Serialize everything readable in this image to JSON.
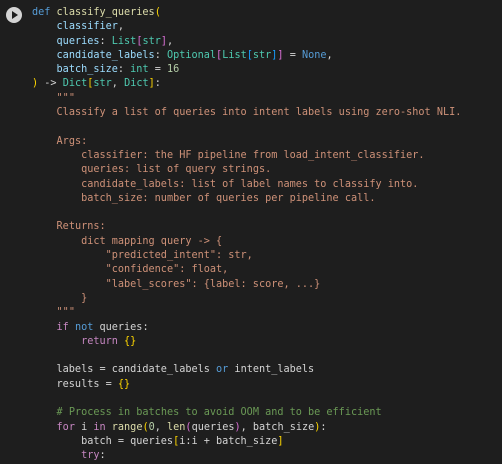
{
  "run_icon": "play-circle-icon",
  "colors": {
    "background": "#1e1e1e",
    "keyword": "#569cd6",
    "control": "#c586c0",
    "function": "#dcdcaa",
    "type": "#4ec9b0",
    "parameter": "#9cdcfe",
    "string": "#ce9178",
    "number": "#b5cea8",
    "comment": "#6a9955"
  },
  "code_lines": [
    [
      [
        "kw",
        "def"
      ],
      [
        "pl",
        " "
      ],
      [
        "fn",
        "classify_queries"
      ],
      [
        "br1",
        "("
      ]
    ],
    [
      [
        "pl",
        "    "
      ],
      [
        "par",
        "classifier"
      ],
      [
        "pl",
        ","
      ]
    ],
    [
      [
        "pl",
        "    "
      ],
      [
        "par",
        "queries"
      ],
      [
        "pl",
        ": "
      ],
      [
        "ty",
        "List"
      ],
      [
        "br2",
        "["
      ],
      [
        "ty",
        "str"
      ],
      [
        "br2",
        "]"
      ],
      [
        "pl",
        ","
      ]
    ],
    [
      [
        "pl",
        "    "
      ],
      [
        "par",
        "candidate_labels"
      ],
      [
        "pl",
        ": "
      ],
      [
        "ty",
        "Optional"
      ],
      [
        "br2",
        "["
      ],
      [
        "ty",
        "List"
      ],
      [
        "br3",
        "["
      ],
      [
        "ty",
        "str"
      ],
      [
        "br3",
        "]"
      ],
      [
        "br2",
        "]"
      ],
      [
        "pl",
        " = "
      ],
      [
        "kw",
        "None"
      ],
      [
        "pl",
        ","
      ]
    ],
    [
      [
        "pl",
        "    "
      ],
      [
        "par",
        "batch_size"
      ],
      [
        "pl",
        ": "
      ],
      [
        "ty",
        "int"
      ],
      [
        "pl",
        " = "
      ],
      [
        "num",
        "16"
      ]
    ],
    [
      [
        "br1",
        ")"
      ],
      [
        "pl",
        " -> "
      ],
      [
        "ty",
        "Dict"
      ],
      [
        "br1",
        "["
      ],
      [
        "ty",
        "str"
      ],
      [
        "pl",
        ", "
      ],
      [
        "ty",
        "Dict"
      ],
      [
        "br1",
        "]"
      ],
      [
        "pl",
        ":"
      ]
    ],
    [
      [
        "pl",
        "    "
      ],
      [
        "str",
        "\"\"\""
      ]
    ],
    [
      [
        "pl",
        "    "
      ],
      [
        "str",
        "Classify a list of queries into intent labels using zero-shot NLI."
      ]
    ],
    [
      [
        "pl",
        ""
      ]
    ],
    [
      [
        "pl",
        "    "
      ],
      [
        "str",
        "Args:"
      ]
    ],
    [
      [
        "pl",
        "        "
      ],
      [
        "str",
        "classifier: the HF pipeline from load_intent_classifier."
      ]
    ],
    [
      [
        "pl",
        "        "
      ],
      [
        "str",
        "queries: list of query strings."
      ]
    ],
    [
      [
        "pl",
        "        "
      ],
      [
        "str",
        "candidate_labels: list of label names to classify into."
      ]
    ],
    [
      [
        "pl",
        "        "
      ],
      [
        "str",
        "batch_size: number of queries per pipeline call."
      ]
    ],
    [
      [
        "pl",
        ""
      ]
    ],
    [
      [
        "pl",
        "    "
      ],
      [
        "str",
        "Returns:"
      ]
    ],
    [
      [
        "pl",
        "        "
      ],
      [
        "str",
        "dict mapping query -> {"
      ]
    ],
    [
      [
        "pl",
        "            "
      ],
      [
        "str",
        "\"predicted_intent\": str,"
      ]
    ],
    [
      [
        "pl",
        "            "
      ],
      [
        "str",
        "\"confidence\": float,"
      ]
    ],
    [
      [
        "pl",
        "            "
      ],
      [
        "str",
        "\"label_scores\": {label: score, ...}"
      ]
    ],
    [
      [
        "pl",
        "        "
      ],
      [
        "str",
        "}"
      ]
    ],
    [
      [
        "pl",
        "    "
      ],
      [
        "str",
        "\"\"\""
      ]
    ],
    [
      [
        "pl",
        "    "
      ],
      [
        "ctl",
        "if"
      ],
      [
        "pl",
        " "
      ],
      [
        "kw",
        "not"
      ],
      [
        "pl",
        " queries:"
      ]
    ],
    [
      [
        "pl",
        "        "
      ],
      [
        "ctl",
        "return"
      ],
      [
        "pl",
        " "
      ],
      [
        "br1",
        "{}"
      ]
    ],
    [
      [
        "pl",
        ""
      ]
    ],
    [
      [
        "pl",
        "    labels = candidate_labels "
      ],
      [
        "kw",
        "or"
      ],
      [
        "pl",
        " intent_labels"
      ]
    ],
    [
      [
        "pl",
        "    results = "
      ],
      [
        "br1",
        "{}"
      ]
    ],
    [
      [
        "pl",
        ""
      ]
    ],
    [
      [
        "pl",
        "    "
      ],
      [
        "com",
        "# Process in batches to avoid OOM and to be efficient"
      ]
    ],
    [
      [
        "pl",
        "    "
      ],
      [
        "ctl",
        "for"
      ],
      [
        "pl",
        " i "
      ],
      [
        "ctl",
        "in"
      ],
      [
        "pl",
        " "
      ],
      [
        "fn",
        "range"
      ],
      [
        "br1",
        "("
      ],
      [
        "num",
        "0"
      ],
      [
        "pl",
        ", "
      ],
      [
        "fn",
        "len"
      ],
      [
        "br2",
        "("
      ],
      [
        "pl",
        "queries"
      ],
      [
        "br2",
        ")"
      ],
      [
        "pl",
        ", batch_size"
      ],
      [
        "br1",
        ")"
      ],
      [
        "pl",
        ":"
      ]
    ],
    [
      [
        "pl",
        "        batch = queries"
      ],
      [
        "br1",
        "["
      ],
      [
        "pl",
        "i:i + batch_size"
      ],
      [
        "br1",
        "]"
      ]
    ],
    [
      [
        "pl",
        "        "
      ],
      [
        "ctl",
        "try"
      ],
      [
        "pl",
        ":"
      ]
    ]
  ]
}
